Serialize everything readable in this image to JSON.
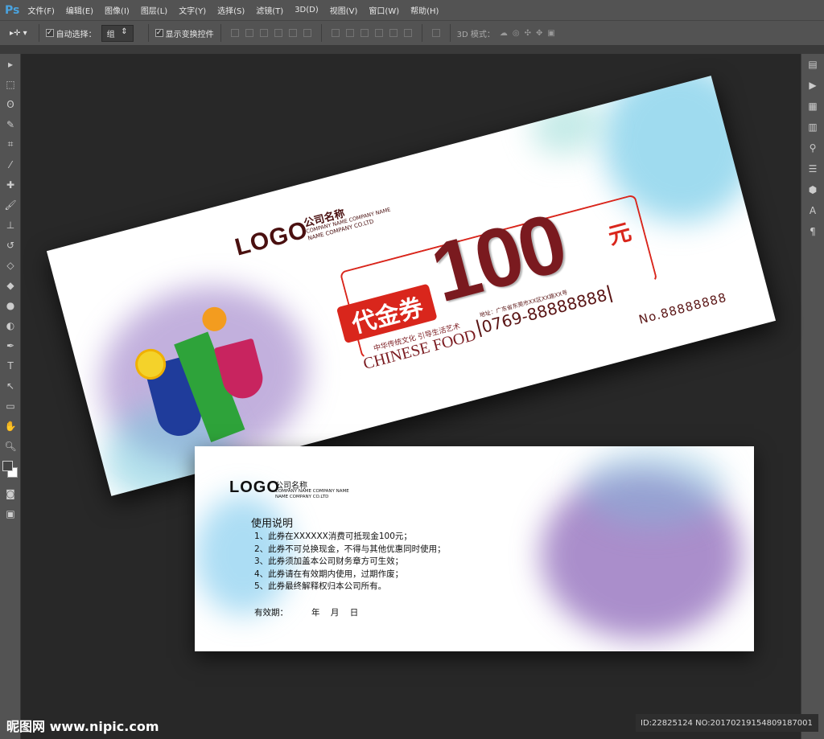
{
  "app": {
    "logo": "Ps"
  },
  "menu": [
    "文件(F)",
    "编辑(E)",
    "图像(I)",
    "图层(L)",
    "文字(Y)",
    "选择(S)",
    "滤镜(T)",
    "3D(D)",
    "视图(V)",
    "窗口(W)",
    "帮助(H)"
  ],
  "options": {
    "auto_select_label": "自动选择：",
    "auto_select_value": "组",
    "show_transform_label": "显示变换控件",
    "mode_3d_label": "3D 模式："
  },
  "front": {
    "logo": "LOGO",
    "company_cn": "公司名称",
    "company_en1": "COMPANY NAME COMPANY NAME",
    "company_en2": "NAME COMPANY CO.LTD",
    "voucher_label": "代金券",
    "amount": "100",
    "currency": "元",
    "address": "地址：广东省东莞市XX区XX路XX号",
    "phone": "0769-88888888",
    "slogan": "中华传统文化 引导生活艺术",
    "food": "CHINESE FOOD",
    "serial": "No.88888888"
  },
  "back": {
    "logo": "LOGO",
    "company_cn": "公司名称",
    "company_en1": "COMPANY NAME COMPANY NAME",
    "company_en2": "NAME COMPANY CO.LTD",
    "title": "使用说明",
    "rules": [
      "1、此券在XXXXXX消费可抵现金100元；",
      "2、此券不可兑换现金，不得与其他优惠同时使用；",
      "3、此券须加盖本公司财务章方可生效；",
      "4、此券请在有效期内使用，过期作废；",
      "5、此券最终解释权归本公司所有。"
    ],
    "validity_label": "有效期：",
    "validity_date": "年    月    日"
  },
  "watermark": {
    "site": "昵图网 www.nipic.com",
    "id": "ID:22825124 NO:20170219154809187001"
  },
  "colors": {
    "accent": "#d9261c",
    "dark_red": "#7a1a1f",
    "ps_blue": "#4aa3df"
  }
}
